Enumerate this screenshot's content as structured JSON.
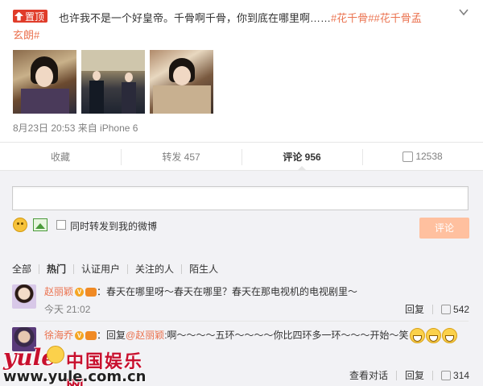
{
  "post": {
    "pin_label": "置顶",
    "text_prefix": "也许我不是一个好皇帝。千骨啊千骨，你到底在哪里啊……",
    "tag1": "#花千骨#",
    "tag2": "#花千骨孟",
    "tag2_cont": "玄朗#",
    "meta": "8月23日 20:53 来自 iPhone 6"
  },
  "actions": {
    "collect": "收藏",
    "repost": "转发 457",
    "comment": "评论 956",
    "like": "12538"
  },
  "composer": {
    "input_value": "",
    "also_repost_label": "同时转发到我的微博",
    "submit_label": "评论"
  },
  "filters": [
    "全部",
    "热门",
    "认证用户",
    "关注的人",
    "陌生人"
  ],
  "comments": [
    {
      "name": "赵丽颖",
      "text": "：春天在哪里呀～春天在哪里？春天在那电视机的电视剧里～",
      "time": "今天 21:02",
      "reply": "回复",
      "likes": "542"
    },
    {
      "name": "徐海乔",
      "reply_prefix": "：回复",
      "reply_target": "@赵丽颖",
      "text": ":啊～～～～五环～～～～你比四环多一环～～～开始～笑",
      "view_convo": "查看对话",
      "reply": "回复",
      "likes": "314"
    }
  ],
  "watermark": {
    "yule": "yule",
    "cn": "中国娱乐网",
    "url": "www.yule.com.cn"
  },
  "colors": {
    "accent": "#eb7350",
    "pin_red": "#e03c2a",
    "submit_disabled": "#ffc09f"
  }
}
